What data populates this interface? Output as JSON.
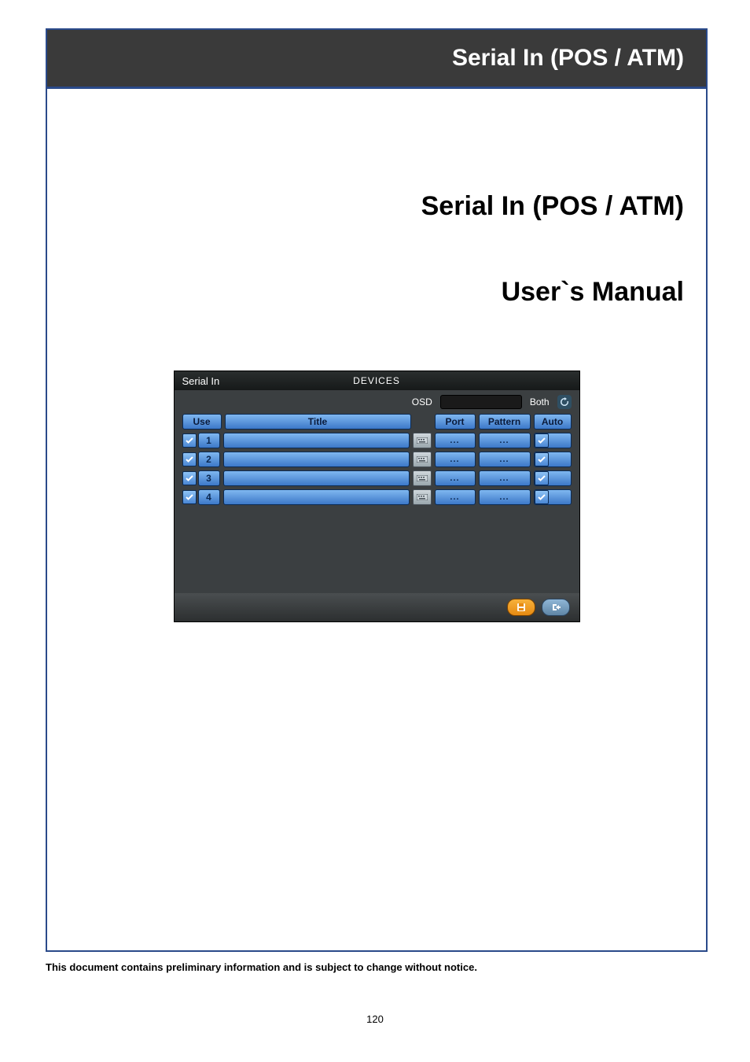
{
  "header": {
    "title": "Serial In (POS / ATM)"
  },
  "titles": {
    "main": "Serial In (POS / ATM)",
    "sub": "User`s Manual"
  },
  "window": {
    "tab": "Serial In",
    "section": "DEVICES",
    "osd": {
      "label": "OSD",
      "mode": "Both"
    },
    "columns": {
      "use": "Use",
      "title": "Title",
      "port": "Port",
      "pattern": "Pattern",
      "auto": "Auto"
    },
    "rows": [
      {
        "use": true,
        "num": "1",
        "title": "",
        "port": "...",
        "pattern": "...",
        "auto": true
      },
      {
        "use": true,
        "num": "2",
        "title": "",
        "port": "...",
        "pattern": "...",
        "auto": true
      },
      {
        "use": true,
        "num": "3",
        "title": "",
        "port": "...",
        "pattern": "...",
        "auto": true
      },
      {
        "use": true,
        "num": "4",
        "title": "",
        "port": "...",
        "pattern": "...",
        "auto": true
      }
    ]
  },
  "footer": {
    "disclaimer": "This document contains preliminary information and is subject to change without notice.",
    "page": "120"
  }
}
